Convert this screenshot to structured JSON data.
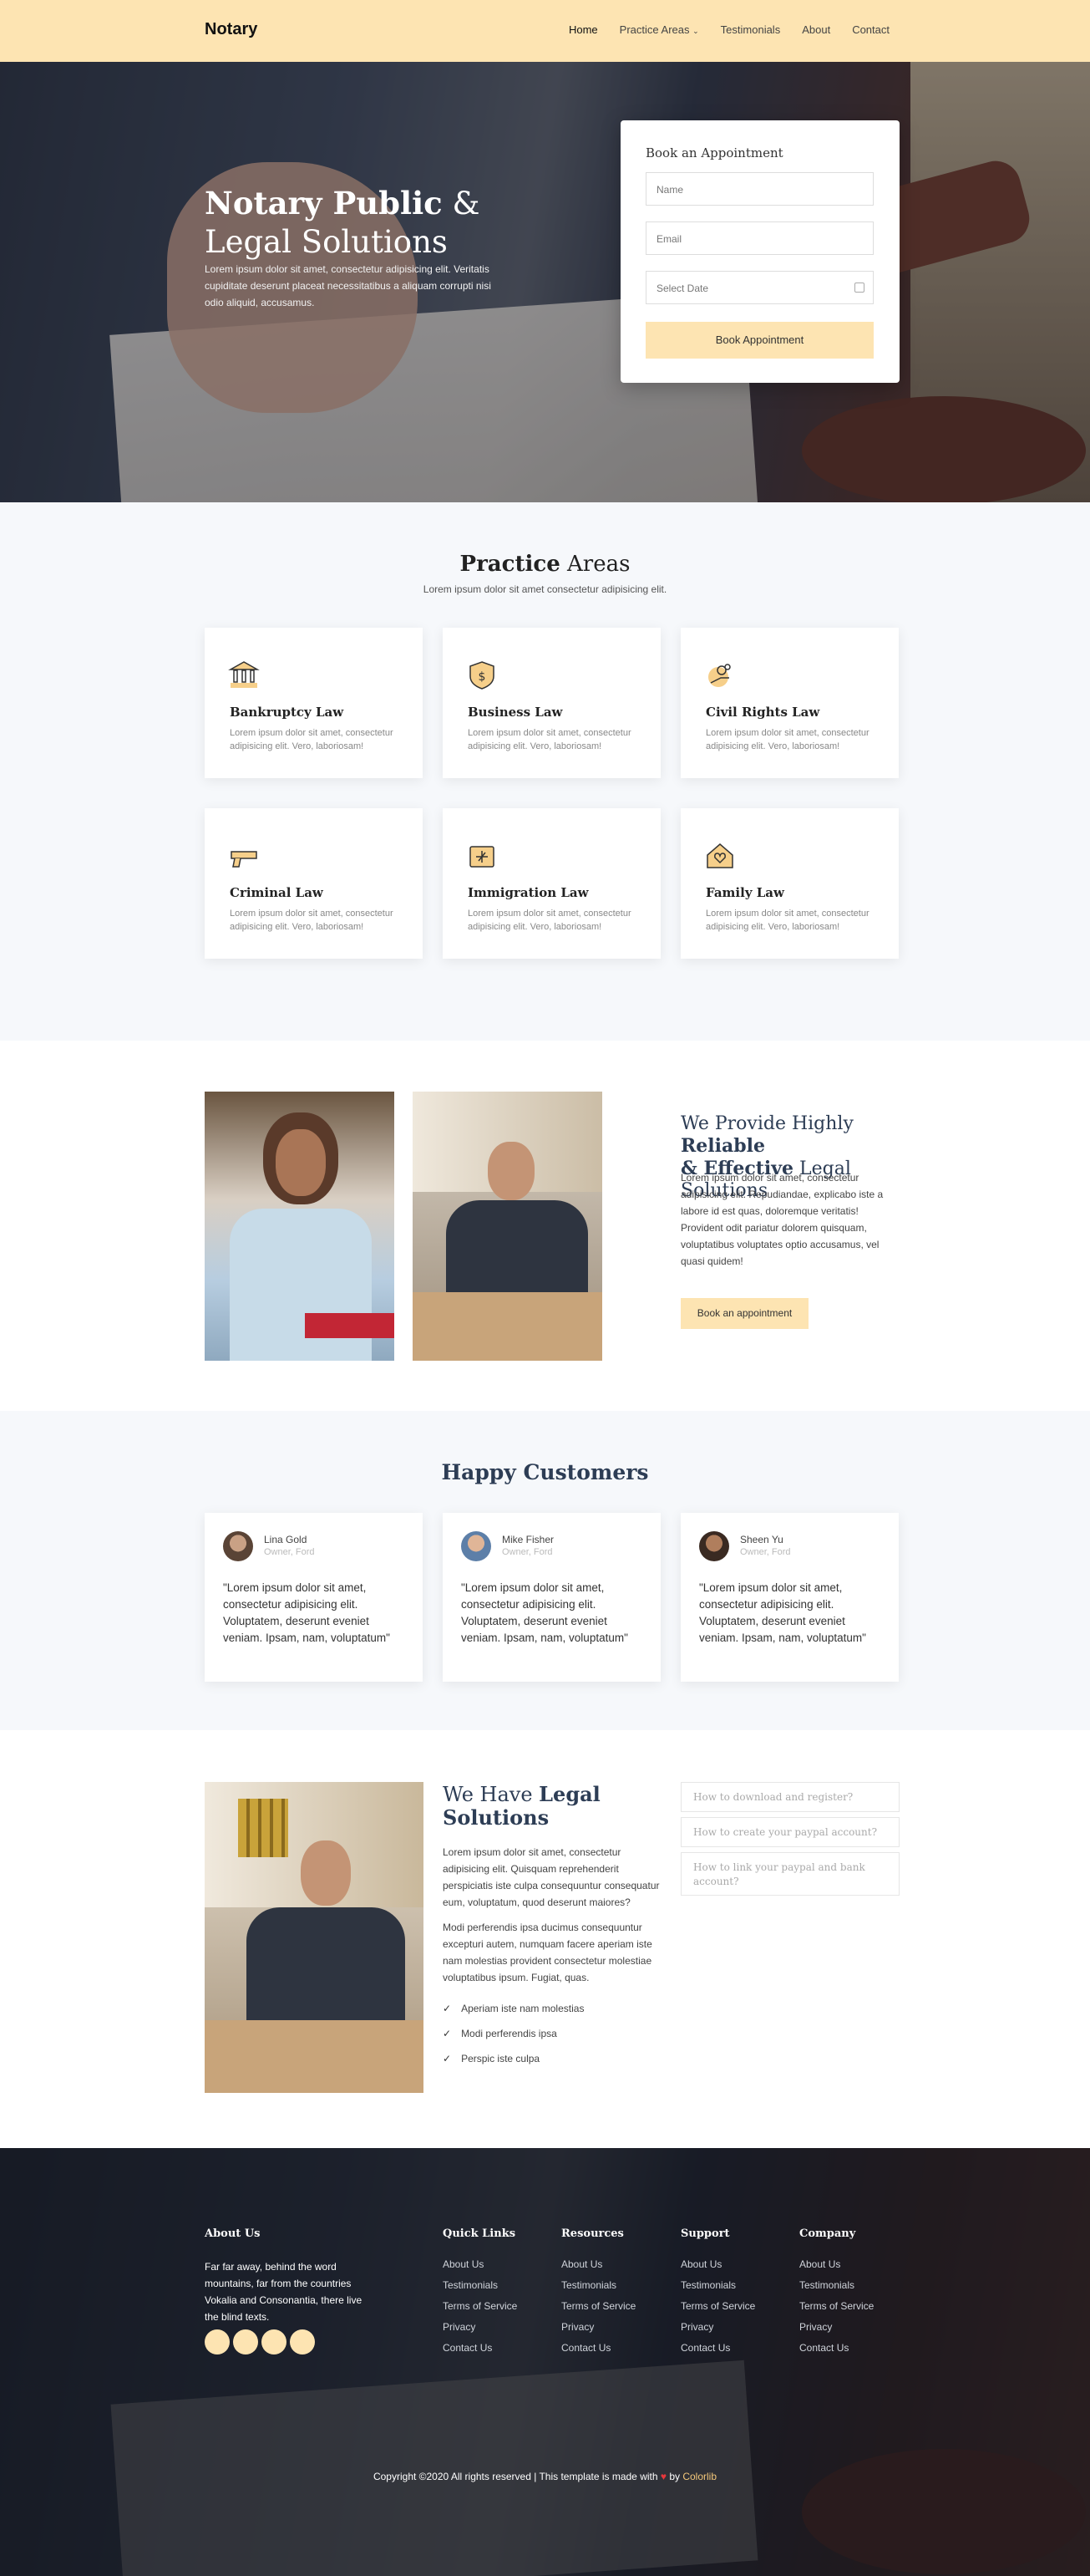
{
  "nav": {
    "brand": "Notary",
    "links": [
      "Home",
      "Practice Areas",
      "Testimonials",
      "About",
      "Contact"
    ]
  },
  "hero": {
    "title_bold": "Notary Public",
    "title_amp": " &",
    "title_line2": "Legal Solutions",
    "text": "Lorem ipsum dolor sit amet, consectetur adipisicing elit. Veritatis cupiditate deserunt placeat necessitatibus a aliquam corrupti nisi odio aliquid, accusamus.",
    "form": {
      "title": "Book an Appointment",
      "name_placeholder": "Name",
      "email_placeholder": "Email",
      "date_placeholder": "Select Date",
      "button": "Book Appointment"
    }
  },
  "practice": {
    "title_bold": "Practice",
    "title_rest": " Areas",
    "subtitle": "Lorem ipsum dolor sit amet consectetur adipisicing elit.",
    "cards": [
      {
        "title": "Bankruptcy Law",
        "text": "Lorem ipsum dolor sit amet, consectetur adipisicing elit. Vero, laboriosam!",
        "icon": "building-columns-icon"
      },
      {
        "title": "Business Law",
        "text": "Lorem ipsum dolor sit amet, consectetur adipisicing elit. Vero, laboriosam!",
        "icon": "dollar-shield-icon"
      },
      {
        "title": "Civil Rights Law",
        "text": "Lorem ipsum dolor sit amet, consectetur adipisicing elit. Vero, laboriosam!",
        "icon": "gears-hand-icon"
      },
      {
        "title": "Criminal Law",
        "text": "Lorem ipsum dolor sit amet, consectetur adipisicing elit. Vero, laboriosam!",
        "icon": "gun-icon"
      },
      {
        "title": "Immigration Law",
        "text": "Lorem ipsum dolor sit amet, consectetur adipisicing elit. Vero, laboriosam!",
        "icon": "passport-plane-icon"
      },
      {
        "title": "Family Law",
        "text": "Lorem ipsum dolor sit amet, consectetur adipisicing elit. Vero, laboriosam!",
        "icon": "house-heart-icon"
      }
    ]
  },
  "reliable": {
    "title_a": "We Provide Highly ",
    "title_b": "Reliable",
    "title_c": " & ",
    "title_d": "Effective",
    "title_e": " Legal Solutions",
    "text": "Lorem ipsum dolor sit amet, consectetur adipisicing elit. Repudiandae, explicabo iste a labore id est quas, doloremque veritatis! Provident odit pariatur dolorem quisquam, voluptatibus voluptates optio accusamus, vel quasi quidem!",
    "button": "Book an appointment"
  },
  "customers": {
    "title": "Happy Customers",
    "items": [
      {
        "name": "Lina Gold",
        "role": "Owner, Ford",
        "quote": "\"Lorem ipsum dolor sit amet, consectetur adipisicing elit. Voluptatem, deserunt eveniet veniam. Ipsam, nam, voluptatum\""
      },
      {
        "name": "Mike Fisher",
        "role": "Owner, Ford",
        "quote": "\"Lorem ipsum dolor sit amet, consectetur adipisicing elit. Voluptatem, deserunt eveniet veniam. Ipsam, nam, voluptatum\""
      },
      {
        "name": "Sheen Yu",
        "role": "Owner, Ford",
        "quote": "\"Lorem ipsum dolor sit amet, consectetur adipisicing elit. Voluptatem, deserunt eveniet veniam. Ipsam, nam, voluptatum\""
      }
    ]
  },
  "legal": {
    "title_a": "We Have ",
    "title_b": "Legal",
    "title_c": "Solutions",
    "p1": "Lorem ipsum dolor sit amet, consectetur adipisicing elit. Quisquam reprehenderit perspiciatis iste culpa consequuntur consequatur eum, voluptatum, quod deserunt maiores?",
    "p2": "Modi perferendis ipsa ducimus consequuntur excepturi autem, numquam facere aperiam iste nam molestias provident consectetur molestiae voluptatibus ipsum. Fugiat, quas.",
    "checks": [
      "Aperiam iste nam molestias",
      "Modi perferendis ipsa",
      "Perspic iste culpa"
    ],
    "faq": [
      "How to download and register?",
      "How to create your paypal account?",
      "How to link your paypal and bank account?"
    ]
  },
  "footer": {
    "about_title": "About Us",
    "about_text": "Far far away, behind the word mountains, far from the countries Vokalia and Consonantia, there live the blind texts.",
    "columns": [
      {
        "title": "Quick Links",
        "links": [
          "About Us",
          "Testimonials",
          "Terms of Service",
          "Privacy",
          "Contact Us"
        ]
      },
      {
        "title": "Resources",
        "links": [
          "About Us",
          "Testimonials",
          "Terms of Service",
          "Privacy",
          "Contact Us"
        ]
      },
      {
        "title": "Support",
        "links": [
          "About Us",
          "Testimonials",
          "Terms of Service",
          "Privacy",
          "Contact Us"
        ]
      },
      {
        "title": "Company",
        "links": [
          "About Us",
          "Testimonials",
          "Terms of Service",
          "Privacy",
          "Contact Us"
        ]
      }
    ],
    "copyright_a": "Copyright ©2020 All rights reserved | This template is made with ",
    "heart": "♥",
    "copyright_b": " by ",
    "copyright_link": "Colorlib"
  },
  "colors": {
    "accent": "#fde4b2",
    "heading": "#2d3d55",
    "section_bg": "#f6f8fb"
  }
}
